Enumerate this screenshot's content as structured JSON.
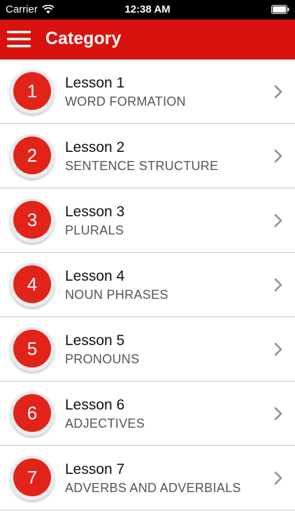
{
  "status_bar": {
    "carrier": "Carrier",
    "time": "12:38 AM",
    "wifi_icon": "wifi-icon",
    "battery_icon": "battery-icon"
  },
  "nav_bar": {
    "title": "Category",
    "menu_icon": "hamburger-menu-icon",
    "background_color": "#d9120f"
  },
  "lessons": [
    {
      "number": "1",
      "title": "Lesson 1",
      "subtitle": "WORD FORMATION"
    },
    {
      "number": "2",
      "title": "Lesson 2",
      "subtitle": "SENTENCE STRUCTURE"
    },
    {
      "number": "3",
      "title": "Lesson 3",
      "subtitle": "PLURALS"
    },
    {
      "number": "4",
      "title": "Lesson 4",
      "subtitle": "NOUN PHRASES"
    },
    {
      "number": "5",
      "title": "Lesson 5",
      "subtitle": "PRONOUNS"
    },
    {
      "number": "6",
      "title": "Lesson 6",
      "subtitle": "ADJECTIVES"
    },
    {
      "number": "7",
      "title": "Lesson 7",
      "subtitle": "ADVERBS AND ADVERBIALS"
    }
  ],
  "colors": {
    "badge": "#e2231a",
    "chevron": "#8e8e93"
  }
}
